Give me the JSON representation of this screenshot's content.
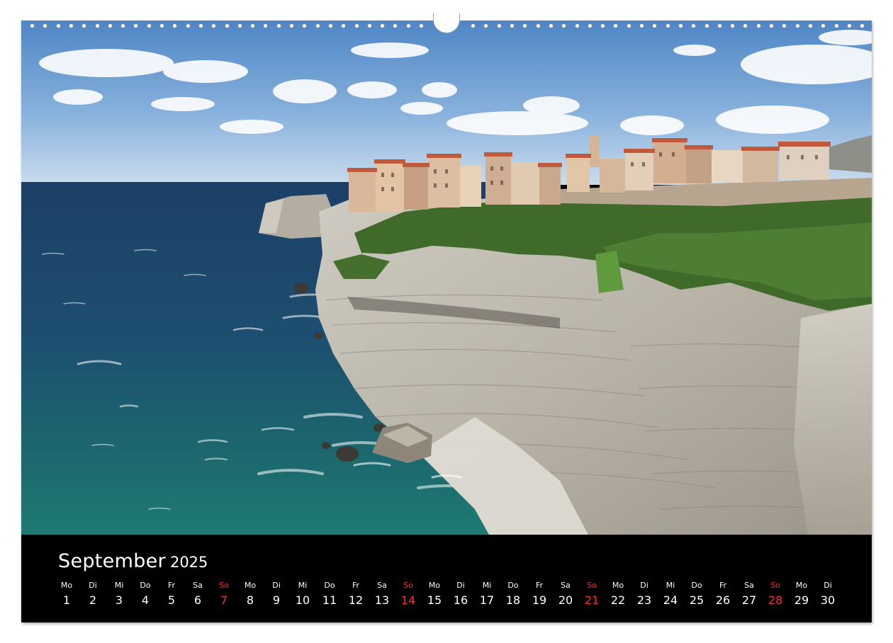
{
  "calendar": {
    "month": "September",
    "year": "2025",
    "weekday_color": "#ffffff",
    "sunday_color": "#ff2a2a",
    "days": [
      {
        "dow": "Mo",
        "num": "1",
        "sunday": false
      },
      {
        "dow": "Di",
        "num": "2",
        "sunday": false
      },
      {
        "dow": "Mi",
        "num": "3",
        "sunday": false
      },
      {
        "dow": "Do",
        "num": "4",
        "sunday": false
      },
      {
        "dow": "Fr",
        "num": "5",
        "sunday": false
      },
      {
        "dow": "Sa",
        "num": "6",
        "sunday": false
      },
      {
        "dow": "So",
        "num": "7",
        "sunday": true
      },
      {
        "dow": "Mo",
        "num": "8",
        "sunday": false
      },
      {
        "dow": "Di",
        "num": "9",
        "sunday": false
      },
      {
        "dow": "Mi",
        "num": "10",
        "sunday": false
      },
      {
        "dow": "Do",
        "num": "11",
        "sunday": false
      },
      {
        "dow": "Fr",
        "num": "12",
        "sunday": false
      },
      {
        "dow": "Sa",
        "num": "13",
        "sunday": false
      },
      {
        "dow": "So",
        "num": "14",
        "sunday": true
      },
      {
        "dow": "Mo",
        "num": "15",
        "sunday": false
      },
      {
        "dow": "Di",
        "num": "16",
        "sunday": false
      },
      {
        "dow": "Mi",
        "num": "17",
        "sunday": false
      },
      {
        "dow": "Do",
        "num": "18",
        "sunday": false
      },
      {
        "dow": "Fr",
        "num": "19",
        "sunday": false
      },
      {
        "dow": "Sa",
        "num": "20",
        "sunday": false
      },
      {
        "dow": "So",
        "num": "21",
        "sunday": true
      },
      {
        "dow": "Mo",
        "num": "22",
        "sunday": false
      },
      {
        "dow": "Di",
        "num": "23",
        "sunday": false
      },
      {
        "dow": "Mi",
        "num": "24",
        "sunday": false
      },
      {
        "dow": "Do",
        "num": "25",
        "sunday": false
      },
      {
        "dow": "Fr",
        "num": "26",
        "sunday": false
      },
      {
        "dow": "Sa",
        "num": "27",
        "sunday": false
      },
      {
        "dow": "So",
        "num": "28",
        "sunday": true
      },
      {
        "dow": "Mo",
        "num": "29",
        "sunday": false
      },
      {
        "dow": "Di",
        "num": "30",
        "sunday": false
      }
    ]
  }
}
